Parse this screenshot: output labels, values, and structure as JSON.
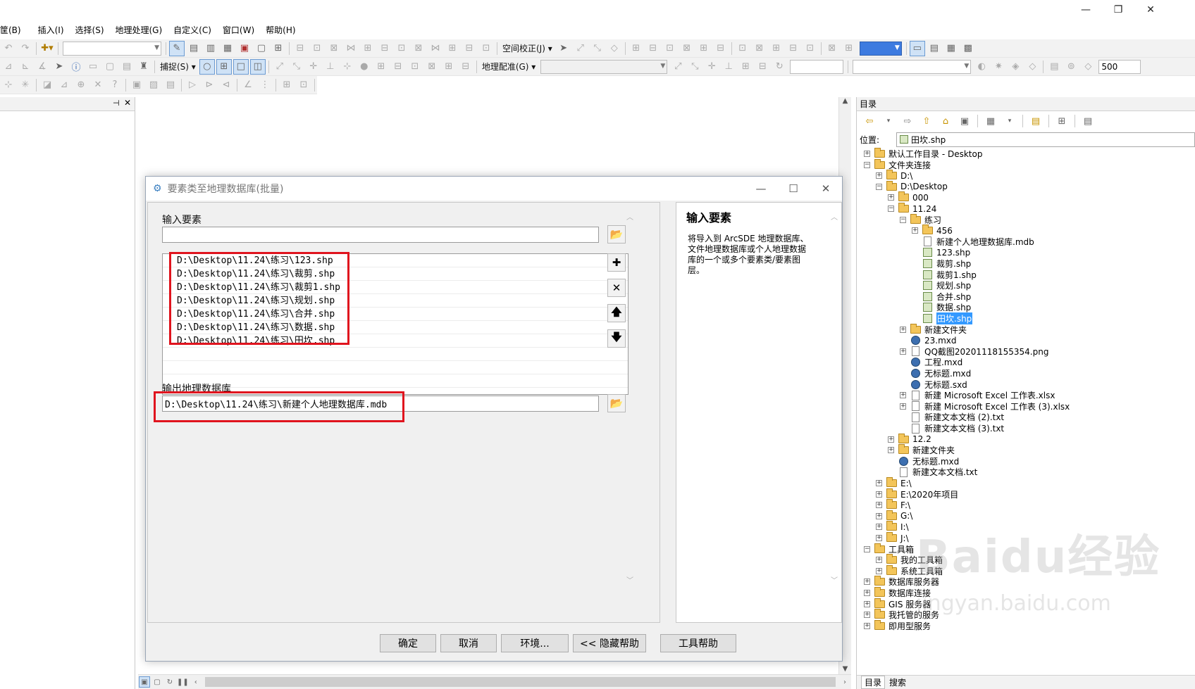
{
  "menu": [
    "筐(B)",
    "插入(I)",
    "选择(S)",
    "地理处理(G)",
    "自定义(C)",
    "窗口(W)",
    "帮助(H)"
  ],
  "toolbar": {
    "spatial_adjust": "空间校正(J) ▾",
    "snap": "捕捉(S) ▾",
    "georef": "地理配准(G) ▾",
    "scale_value": "500"
  },
  "catalog": {
    "title": "目录",
    "location_label": "位置:",
    "location_value": "田坎.shp",
    "tree": [
      {
        "label": "默认工作目录 - Desktop",
        "indent": 0,
        "exp": "+",
        "icon": "folder"
      },
      {
        "label": "文件夹连接",
        "indent": 0,
        "exp": "-",
        "icon": "folder"
      },
      {
        "label": "D:\\",
        "indent": 1,
        "exp": "+",
        "icon": "folder"
      },
      {
        "label": "D:\\Desktop",
        "indent": 1,
        "exp": "-",
        "icon": "folder"
      },
      {
        "label": "000",
        "indent": 2,
        "exp": "+",
        "icon": "folder"
      },
      {
        "label": "11.24",
        "indent": 2,
        "exp": "-",
        "icon": "folder"
      },
      {
        "label": "练习",
        "indent": 3,
        "exp": "-",
        "icon": "folder"
      },
      {
        "label": "456",
        "indent": 4,
        "exp": "+",
        "icon": "folder"
      },
      {
        "label": "新建个人地理数据库.mdb",
        "indent": 4,
        "exp": "",
        "icon": "doc"
      },
      {
        "label": "123.shp",
        "indent": 4,
        "exp": "",
        "icon": "shp"
      },
      {
        "label": "裁剪.shp",
        "indent": 4,
        "exp": "",
        "icon": "shp"
      },
      {
        "label": "裁剪1.shp",
        "indent": 4,
        "exp": "",
        "icon": "shp"
      },
      {
        "label": "规划.shp",
        "indent": 4,
        "exp": "",
        "icon": "shp"
      },
      {
        "label": "合并.shp",
        "indent": 4,
        "exp": "",
        "icon": "shp"
      },
      {
        "label": "数据.shp",
        "indent": 4,
        "exp": "",
        "icon": "shp"
      },
      {
        "label": "田坎.shp",
        "indent": 4,
        "exp": "",
        "icon": "shp",
        "selected": true
      },
      {
        "label": "新建文件夹",
        "indent": 3,
        "exp": "+",
        "icon": "folder"
      },
      {
        "label": "23.mxd",
        "indent": 3,
        "exp": "",
        "icon": "mxd"
      },
      {
        "label": "QQ截图20201118155354.png",
        "indent": 3,
        "exp": "+",
        "icon": "doc"
      },
      {
        "label": "工程.mxd",
        "indent": 3,
        "exp": "",
        "icon": "mxd"
      },
      {
        "label": "无标题.mxd",
        "indent": 3,
        "exp": "",
        "icon": "mxd"
      },
      {
        "label": "无标题.sxd",
        "indent": 3,
        "exp": "",
        "icon": "mxd"
      },
      {
        "label": "新建 Microsoft Excel 工作表.xlsx",
        "indent": 3,
        "exp": "+",
        "icon": "doc"
      },
      {
        "label": "新建 Microsoft Excel 工作表 (3).xlsx",
        "indent": 3,
        "exp": "+",
        "icon": "doc"
      },
      {
        "label": "新建文本文档 (2).txt",
        "indent": 3,
        "exp": "",
        "icon": "doc"
      },
      {
        "label": "新建文本文档 (3).txt",
        "indent": 3,
        "exp": "",
        "icon": "doc"
      },
      {
        "label": "12.2",
        "indent": 2,
        "exp": "+",
        "icon": "folder"
      },
      {
        "label": "新建文件夹",
        "indent": 2,
        "exp": "+",
        "icon": "folder"
      },
      {
        "label": "无标题.mxd",
        "indent": 2,
        "exp": "",
        "icon": "mxd"
      },
      {
        "label": "新建文本文档.txt",
        "indent": 2,
        "exp": "",
        "icon": "doc"
      },
      {
        "label": "E:\\",
        "indent": 1,
        "exp": "+",
        "icon": "folder"
      },
      {
        "label": "E:\\2020年项目",
        "indent": 1,
        "exp": "+",
        "icon": "folder"
      },
      {
        "label": "F:\\",
        "indent": 1,
        "exp": "+",
        "icon": "folder"
      },
      {
        "label": "G:\\",
        "indent": 1,
        "exp": "+",
        "icon": "folder"
      },
      {
        "label": "I:\\",
        "indent": 1,
        "exp": "+",
        "icon": "folder"
      },
      {
        "label": "J:\\",
        "indent": 1,
        "exp": "+",
        "icon": "folder"
      },
      {
        "label": "工具箱",
        "indent": 0,
        "exp": "-",
        "icon": "folder"
      },
      {
        "label": "我的工具箱",
        "indent": 1,
        "exp": "+",
        "icon": "folder"
      },
      {
        "label": "系统工具箱",
        "indent": 1,
        "exp": "+",
        "icon": "folder"
      },
      {
        "label": "数据库服务器",
        "indent": 0,
        "exp": "+",
        "icon": "folder"
      },
      {
        "label": "数据库连接",
        "indent": 0,
        "exp": "+",
        "icon": "folder"
      },
      {
        "label": "GIS 服务器",
        "indent": 0,
        "exp": "+",
        "icon": "folder"
      },
      {
        "label": "我托管的服务",
        "indent": 0,
        "exp": "+",
        "icon": "folder"
      },
      {
        "label": "即用型服务",
        "indent": 0,
        "exp": "+",
        "icon": "folder"
      }
    ],
    "tabs": [
      "目录",
      "搜索"
    ]
  },
  "dialog": {
    "title": "要素类至地理数据库(批量)",
    "input_label": "输入要素",
    "input_value": "",
    "input_list": [
      "D:\\Desktop\\11.24\\练习\\123.shp",
      "D:\\Desktop\\11.24\\练习\\裁剪.shp",
      "D:\\Desktop\\11.24\\练习\\裁剪1.shp",
      "D:\\Desktop\\11.24\\练习\\规划.shp",
      "D:\\Desktop\\11.24\\练习\\合并.shp",
      "D:\\Desktop\\11.24\\练习\\数据.shp",
      "D:\\Desktop\\11.24\\练习\\田坎.shp"
    ],
    "output_label": "输出地理数据库",
    "output_value": "D:\\Desktop\\11.24\\练习\\新建个人地理数据库.mdb",
    "buttons": {
      "ok": "确定",
      "cancel": "取消",
      "env": "环境...",
      "hide_help": "<< 隐藏帮助",
      "tool_help": "工具帮助"
    },
    "help_title": "输入要素",
    "help_text": "将导入到 ArcSDE 地理数据库、文件地理数据库或个人地理数据库的一个或多个要素类/要素图层。"
  },
  "watermark": {
    "text": "Baidu经验",
    "url": "jingyan.baidu.com"
  },
  "colors": {
    "highlight": "#e0141e",
    "selection": "#3399ff"
  }
}
